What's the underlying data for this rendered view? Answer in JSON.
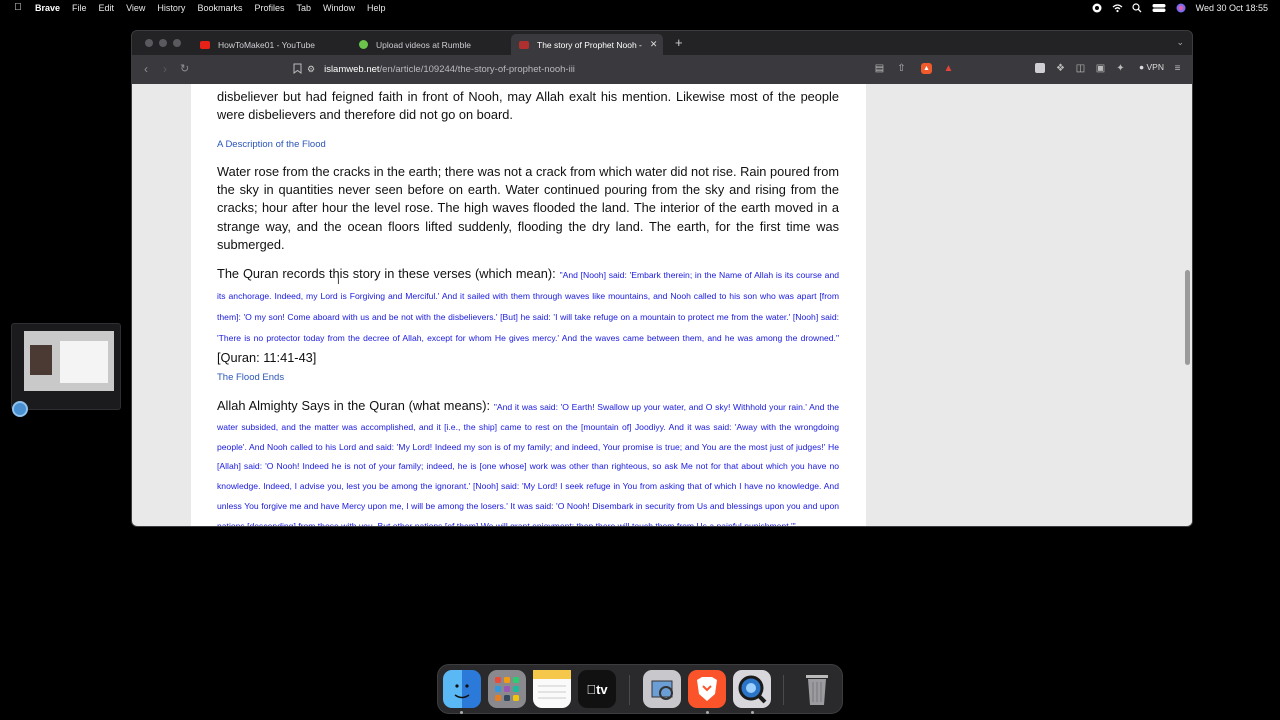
{
  "menubar": {
    "app": "Brave",
    "items": [
      "File",
      "Edit",
      "View",
      "History",
      "Bookmarks",
      "Profiles",
      "Tab",
      "Window",
      "Help"
    ],
    "clock": "Wed 30 Oct  18:55"
  },
  "browser": {
    "tabs": [
      {
        "title": "HowToMake01 - YouTube",
        "favicon_color": "#e62117"
      },
      {
        "title": "Upload videos at Rumble",
        "favicon_color": "#6bc54b"
      },
      {
        "title": "The story of Prophet Nooh -",
        "favicon_color": "#b03030",
        "active": true
      }
    ],
    "new_tab": "+",
    "url_host": "islamweb.net",
    "url_path": "/en/article/109244/the-story-of-prophet-nooh-iii",
    "vpn_label": "VPN"
  },
  "article": {
    "para1": "disbeliever but had feigned faith in front of Nooh, may Allah exalt his mention. Likewise most of the people were disbelievers and therefore did not go on board.",
    "heading1": "A Description of the Flood",
    "para2": "Water rose from the cracks in the earth; there was not a crack from which water did not rise. Rain poured from the sky in quantities never seen before on earth. Water continued pouring from the sky and rising from the cracks; hour after hour the level rose. The high waves flooded the land. The interior of the earth moved in a strange way, and the ocean floors lifted suddenly, flooding the dry land. The earth, for the first time was submerged.",
    "para3_lead": "The Quran records this story in these verses (which mean): ",
    "para3_verse": "\"And [Nooh] said: 'Embark therein; in the Name of Allah is its course and its anchorage. Indeed, my Lord is Forgiving and Merciful.' And it sailed with them through waves like mountains, and Nooh called to his son who was apart [from them]: 'O my son! Come aboard with us and be not with the disbelievers.' [But] he said: 'I will take refuge on a mountain to protect me from the water.' [Nooh] said: 'There is no protector today from the decree of Allah, except for whom He gives mercy.' And the waves came between them, and he was among the drowned.\"",
    "para3_ref": " [Quran: 11:41-43]",
    "heading2": "The Flood Ends",
    "para4_lead": "Allah Almighty Says in the Quran (what means): ",
    "para4_verse": "\"And it was said: 'O Earth! Swallow up your water, and O sky! Withhold your rain.' And the water subsided, and the matter was accomplished, and it [i.e., the ship] came to rest on the [mountain of] Joodiyy. And it was said: 'Away with the wrongdoing people'. And Nooh called to his Lord and said: 'My Lord! Indeed my son is of my family; and indeed, Your promise is true; and You are the most just of judges!' He [Allah] said: 'O Nooh! Indeed he is not of your family; indeed, he is [one whose] work was other than righteous, so ask Me not for that about which you have no knowledge. Indeed, I advise you, lest you be among the ignorant.' [Nooh] said: 'My Lord! I seek refuge in You from asking that of which I have no knowledge. And unless You forgive me and have Mercy upon me, I will be among the losers.' It was said: 'O Nooh! Disembark in security from Us and blessings upon you and upon nations [descending] from those with you. But other nations [of them] We will grant enjoyment; then there will touch them from Us a painful punishment.'\""
  },
  "dock": {
    "apps": [
      "finder-icon",
      "launchpad-icon",
      "notes-icon",
      "apple-tv-icon",
      "preview-icon",
      "brave-icon",
      "quicktime-icon",
      "trash-icon"
    ],
    "tv_label": "tv"
  }
}
